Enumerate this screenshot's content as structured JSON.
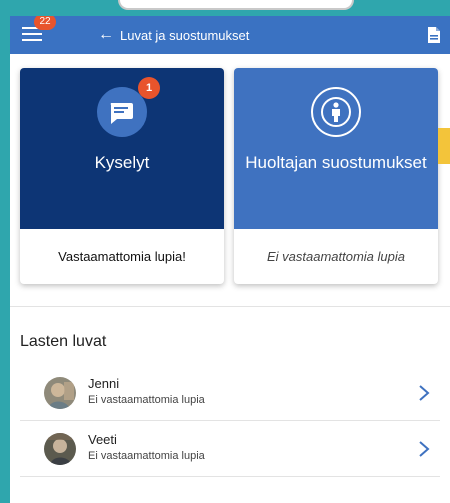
{
  "header": {
    "notification_count": "22",
    "back_title": "Luvat ja suostumukset",
    "icons": {
      "menu": "hamburger-menu-icon",
      "back": "back-arrow-icon",
      "document": "document-icon"
    }
  },
  "cards": [
    {
      "title": "Kyselyt",
      "badge": "1",
      "status": "Vastaamattomia lupia!",
      "icon": "chat-icon",
      "color": "#0d3575"
    },
    {
      "title": "Huoltajan suostumukset",
      "status": "Ei vastaamattomia lupia",
      "icon": "person-info-icon",
      "color": "#3f72c0"
    }
  ],
  "children_section": {
    "title": "Lasten luvat",
    "items": [
      {
        "name": "Jenni",
        "status": "Ei vastaamattomia lupia"
      },
      {
        "name": "Veeti",
        "status": "Ei vastaamattomia lupia"
      }
    ]
  },
  "colors": {
    "header_blue": "#3a72c2",
    "badge_orange": "#e8542c",
    "accent_yellow": "#f3c43a",
    "chevron_blue": "#3f72c0"
  }
}
